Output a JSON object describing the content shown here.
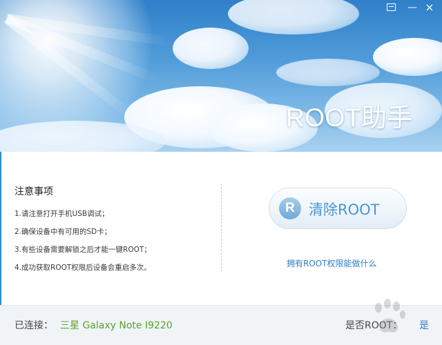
{
  "window": {
    "title": "ROOT助手",
    "controls": {
      "menu": "menu-icon",
      "minimize": "—",
      "close": "×"
    }
  },
  "notes": {
    "title": "注意事项",
    "items": [
      "1.请注意打开手机USB调试；",
      "2.确保设备中有可用的SD卡；",
      "3.有些设备需要解锁之后才能一键ROOT；",
      "4.成功获取ROOT权限后设备会重启多次。"
    ]
  },
  "actions": {
    "clear_root": {
      "icon_letter": "R",
      "label": "清除ROOT"
    },
    "info_link": "拥有ROOT权限能做什么"
  },
  "status": {
    "connected_label": "已连接：",
    "device": "三星 Galaxy Note I9220",
    "root_question": "是否ROOT：",
    "root_answer": "是"
  },
  "colors": {
    "accent": "#2f7ec4",
    "device_green": "#5aa02c",
    "button_text": "#4d95cf",
    "statusbar_bg": "#f0f4f7"
  }
}
